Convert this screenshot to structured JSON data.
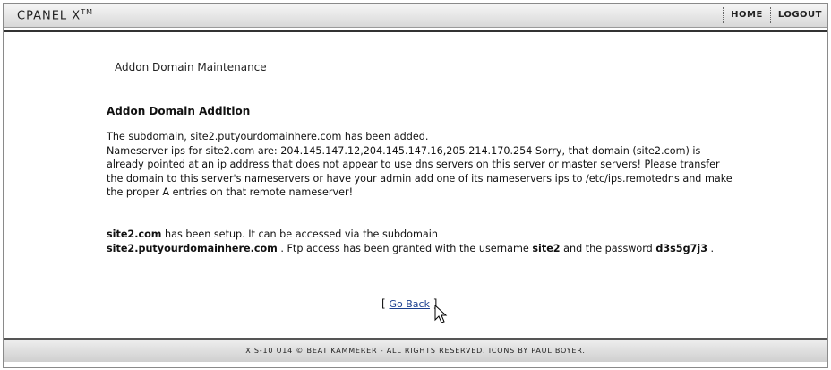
{
  "header": {
    "logo": "CPANEL X",
    "logo_tm": "TM",
    "nav": [
      {
        "label": "HOME"
      },
      {
        "label": "LOGOUT"
      }
    ]
  },
  "page": {
    "title": "Addon Domain Maintenance",
    "section_title": "Addon Domain Addition",
    "line1": "The subdomain, site2.putyourdomainhere.com has been added.",
    "line2": "Nameserver ips for site2.com are: 204.145.147.12,204.145.147.16,205.214.170.254 Sorry, that domain (site2.com) is already pointed at an ip address that does not appear to use dns servers on this server or master servers! Please transfer the domain to this server's nameservers or have your admin add one of its nameservers ips to /etc/ips.remotedns and make the proper A entries on that remote nameserver!",
    "setup_domain": "site2.com",
    "setup_text1": " has been setup. It can be accessed via the subdomain",
    "setup_subdomain": "site2.putyourdomainhere.com",
    "setup_text2": " . Ftp access has been granted with the username ",
    "username": "site2",
    "setup_text3": " and the password ",
    "password": "d3s5g7j3",
    "setup_text4": " .",
    "goback_open": "[ ",
    "goback_label": "Go Back",
    "goback_close": " ]"
  },
  "footer": {
    "text": "X S-10 U14 © BEAT KAMMERER - ALL RIGHTS RESERVED. ICONS BY PAUL BOYER."
  }
}
